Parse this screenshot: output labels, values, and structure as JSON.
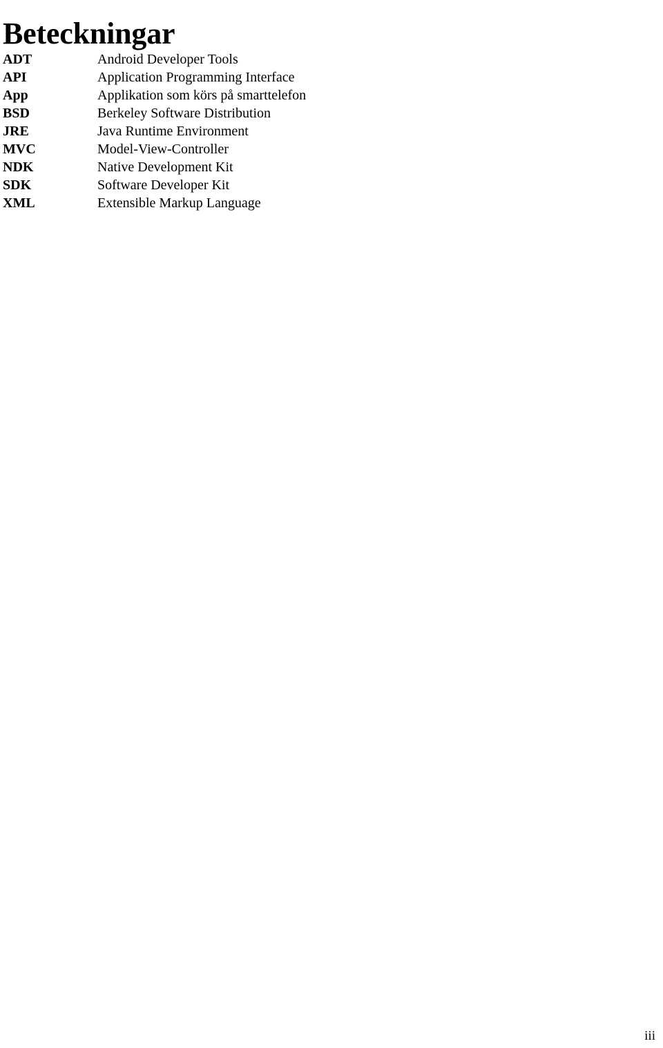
{
  "document": {
    "heading": "Beteckningar",
    "page_number": "iii",
    "abbreviations": [
      {
        "term": "ADT",
        "definition": "Android Developer Tools"
      },
      {
        "term": "API",
        "definition": "Application Programming Interface"
      },
      {
        "term": "App",
        "definition": "Applikation som körs på smarttelefon"
      },
      {
        "term": "BSD",
        "definition": "Berkeley Software Distribution"
      },
      {
        "term": "JRE",
        "definition": "Java Runtime Environment"
      },
      {
        "term": "MVC",
        "definition": "Model-View-Controller"
      },
      {
        "term": "NDK",
        "definition": "Native Development Kit"
      },
      {
        "term": "SDK",
        "definition": "Software Developer Kit"
      },
      {
        "term": "XML",
        "definition": "Extensible Markup Language"
      }
    ]
  }
}
